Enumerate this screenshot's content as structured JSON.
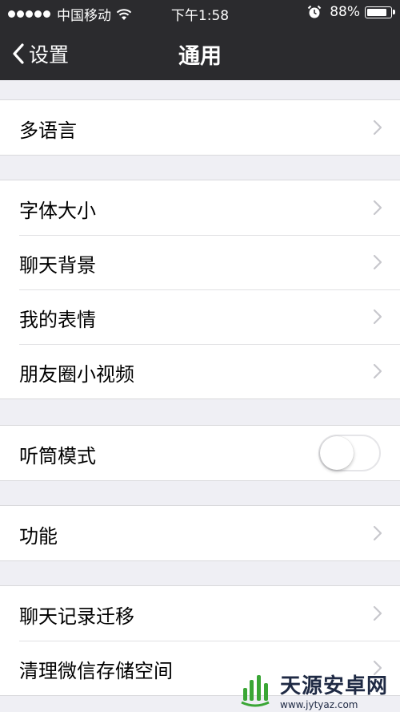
{
  "status_bar": {
    "carrier": "中国移动",
    "time": "下午1:58",
    "battery": "88%",
    "battery_level": 0.88
  },
  "nav": {
    "back_label": "设置",
    "title": "通用"
  },
  "groups": [
    {
      "items": [
        {
          "label": "多语言",
          "control": "chevron"
        }
      ]
    },
    {
      "items": [
        {
          "label": "字体大小",
          "control": "chevron"
        },
        {
          "label": "聊天背景",
          "control": "chevron"
        },
        {
          "label": "我的表情",
          "control": "chevron"
        },
        {
          "label": "朋友圈小视频",
          "control": "chevron"
        }
      ]
    },
    {
      "items": [
        {
          "label": "听筒模式",
          "control": "toggle",
          "value": false
        }
      ]
    },
    {
      "items": [
        {
          "label": "功能",
          "control": "chevron"
        }
      ]
    },
    {
      "items": [
        {
          "label": "聊天记录迁移",
          "control": "chevron"
        },
        {
          "label": "清理微信存储空间",
          "control": "chevron"
        }
      ]
    }
  ],
  "watermark": {
    "name": "天源安卓网",
    "url": "www.jytyaz.com"
  },
  "colors": {
    "nav_background": "#2b2b2e",
    "page_background": "#efeff4",
    "chevron": "#c7c7cc",
    "watermark_green": "#3aa635"
  }
}
